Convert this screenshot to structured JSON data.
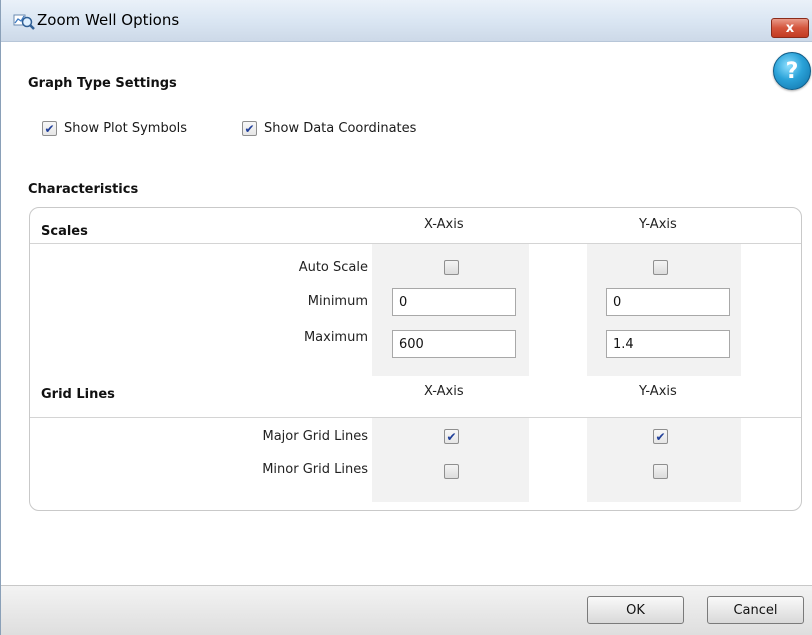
{
  "window": {
    "title": "Zoom Well Options",
    "close_label": "x"
  },
  "help": {
    "label": "?"
  },
  "graph_type": {
    "heading": "Graph Type Settings",
    "show_plot_symbols": {
      "label": "Show Plot Symbols",
      "checked": true
    },
    "show_data_coordinates": {
      "label": "Show Data Coordinates",
      "checked": true
    }
  },
  "characteristics": {
    "heading": "Characteristics",
    "scales": {
      "heading": "Scales",
      "x_header": "X-Axis",
      "y_header": "Y-Axis",
      "auto_scale": {
        "label": "Auto Scale",
        "x_checked": false,
        "y_checked": false
      },
      "minimum": {
        "label": "Minimum",
        "x_value": "0",
        "y_value": "0"
      },
      "maximum": {
        "label": "Maximum",
        "x_value": "600",
        "y_value": "1.4"
      }
    },
    "grid_lines": {
      "heading": "Grid Lines",
      "x_header": "X-Axis",
      "y_header": "Y-Axis",
      "major": {
        "label": "Major Grid Lines",
        "x_checked": true,
        "y_checked": true
      },
      "minor": {
        "label": "Minor Grid Lines",
        "x_checked": false,
        "y_checked": false
      }
    }
  },
  "footer": {
    "ok_label": "OK",
    "cancel_label": "Cancel"
  },
  "colors": {
    "title_bar": "#d9e5f2",
    "close": "#c23b22",
    "help": "#2aa2d8",
    "checkmark": "#21409a"
  },
  "icons": {
    "title": "zoom-magnifier-icon",
    "help": "help-icon",
    "close": "close-icon"
  }
}
